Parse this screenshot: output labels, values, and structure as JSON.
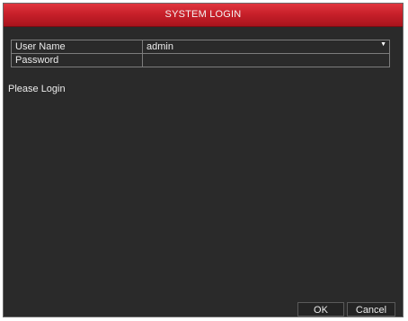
{
  "window": {
    "title": "SYSTEM LOGIN"
  },
  "form": {
    "username_label": "User Name",
    "username_value": "admin",
    "password_label": "Password",
    "password_value": ""
  },
  "status": {
    "message": "Please Login"
  },
  "buttons": {
    "ok_label": "OK",
    "cancel_label": "Cancel"
  },
  "icons": {
    "dropdown": "chevron-down-icon"
  },
  "colors": {
    "title_bar": "#c8202a",
    "panel_background": "#2a2a2a",
    "text": "#ececec"
  }
}
